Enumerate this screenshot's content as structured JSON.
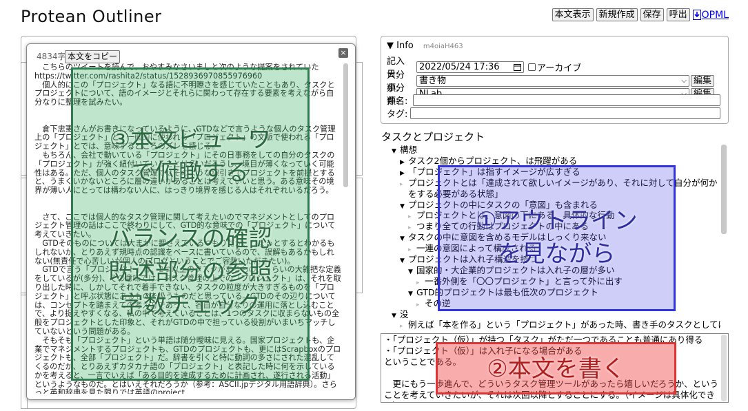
{
  "app": {
    "title": "Protean Outliner"
  },
  "toolbar": {
    "show_body": "本文表示",
    "new": "新規作成",
    "save": "保存",
    "load": "呼出",
    "opml": "OPML"
  },
  "viewer": {
    "char_count": "4834字",
    "copy_label": "本文をコピー",
    "close_label": "×",
    "text": "　こちらのツイートを読んで、おやすみなさいましと次のような提案をされていた\nhttps://twitter.com/rashita2/status/1528936970855976960\n　個人的にこの「プロジェクト」なる語に不明瞭さを感じていたこともあり、タスクとプロジェクトについて、語のイメージとそれらに関わって存在する要素を考えながら自分なりに整理を試みたい。\n\n\n　倉下忠憲さんがお書きになっているように、GTDなどで言うような個人のタスク管理上の「プロジェクト」と、一般的に使われる「プロジェクト」の文脈で使われる「プロジェクト」とでは、意味するところのズレを感じる。\n　もちろん、会社で動いている「プロジェクト」にその日事務をしての自分のタスクの「プロジェクト」が強く紐付いていることは多いだろうし、境目が薄くなっていく可能性はある。ただ、個人のタスク管理ではそのような線引きでプロジェクトを前提とすると、うまくいかないところに層の違いがあることは考えていいと思う。ある意味その境界が薄い人にとっては構わない人に、はっきり境界を感じる人はそれぞれいるだろう。\n\n\n　さて、ここでは個人的なタスク管理に関して考えたいのでマネジメントとしてのプロジェクト管理の話はここで終わりにして、GTD的な意味での「プロジェクト」について考えていきたい。\n　GTDそのものについては大まかに押さえているつもりだが、ひょっとするとわかるもしれないが、とりあえず規時点の認識をベースに書いているので、誤解もあるかもしれない(無責任で心苦しいが個人のブログということでご容赦いただきたい)。\n　GTDで言う「プロジェクト」は、2つ以上のタスクがあるもの、くらいの大雑把な定義をしているが(多分)、その意味では、タスク管理の上での「プロジェクト」は、それを取り出した時に、しかしてそれで着手できない、タスクの粒度が大きすぎるものを「プロジェクト」と呼ぶ状態にあるものを扱うものだと思っている。GTDのその辺りについては、コンセプトを踏まえての考え方であって、各自が自分なりの運用に落とし込むことで、より捉えやすくなる、私の中で考えていることは、1つのタスクに収まらないもの全般をプロジェクトとした印象と、それがGTDの中で担っている役割がいまいちマッチしていないという問題がある。\n　そもそも「プロジェクト」という単語は随分曖昧に見える。国家プロジェクトも、企業でマネジメントするプロジェクトも、GTDのプロジェクトも、更にはScrapboxのプロジェクトも、全部「プロジェクト」だ。辞書を引くと特に動詞の多さにされた混乱してくるのだが、とりあえずカタカナ語の「プロジェクト」と表記した時に何を示しているかを考えると、一言でいえば「ある目的を達成するために計画され、遂行される活動」というようなものだ。とはいえそれだろうか（参考：ASCII.jpデジタル用語辞典）。さらっと英和辞典を見た限りでは英語のproject"
  },
  "info": {
    "heading": "Info",
    "id": "m4oiaH463",
    "date_label": "記入日:",
    "date_value": "2022/05/24 17:36",
    "archive_label": "アーカイブ",
    "category_label": "大分類:",
    "category_value": "書き物",
    "subcategory_label": "小分類:",
    "subcategory_value": "NLab",
    "edit_label": "編集",
    "subject_label": "件名:",
    "subject_value": "",
    "tags_label": "タグ:",
    "tags_value": ""
  },
  "outline": {
    "title": "タスクとプロジェクト",
    "items": [
      {
        "indent": 0,
        "tri": "down",
        "text": "構想"
      },
      {
        "indent": 1,
        "tri": "right",
        "text": "タスク2個からプロジェクト、は飛躍がある"
      },
      {
        "indent": 1,
        "tri": "right",
        "text": "「プロジェクト」は指すイメージが広すぎる"
      },
      {
        "indent": 1,
        "tri": "leaf",
        "text": "プロジェクトとは「達成されて欲しいイメージがあり、それに対して自分が何か"
      },
      {
        "indent": 1,
        "tri": "none",
        "text": "をする必要がある状態」"
      },
      {
        "indent": 1,
        "tri": "down",
        "text": "プロジェクトの中にタスクの「意図」も含まれる"
      },
      {
        "indent": 2,
        "tri": "leaf",
        "text": "プロジェクトとは、意図の下にある、具体的な行動"
      },
      {
        "indent": 2,
        "tri": "leaf",
        "text": "つまり全ての行動はプロジェクトの中にある"
      },
      {
        "indent": 1,
        "tri": "down",
        "text": "タスクの中に意図を含めるモデルはしっくり来ない"
      },
      {
        "indent": 2,
        "tri": "leaf",
        "text": "一連の意図によって構成される"
      },
      {
        "indent": 1,
        "tri": "down",
        "text": "プロジェクトは入れ子構造を持つ"
      },
      {
        "indent": 2,
        "tri": "down",
        "text": "国家的・大企業的プロジェクトは入れ子の層が多い"
      },
      {
        "indent": 3,
        "tri": "leaf",
        "text": "一番外側を「〇〇プロジェクト」と言って外に出す"
      },
      {
        "indent": 2,
        "tri": "down",
        "text": "GTD的プロジェクトは最も低次のプロジェクト"
      },
      {
        "indent": 3,
        "tri": "leaf",
        "text": "その逆"
      },
      {
        "indent": 0,
        "tri": "down",
        "text": "没"
      },
      {
        "indent": 1,
        "tri": "leaf",
        "text": "例えば「本を作る」という「プロジェクト」があった時、書き手のタスクとしては"
      }
    ]
  },
  "body": {
    "text": "・「プロジェクト（仮）」が持つ「タスク」がただ一つであることも普通にあり得る\n・「プロジェクト（仮）」は入れ子になる場合がある\nということである。\n\n　更にもう一歩進んで、どういうタスク管理ツールがあったら嬉しいだろうか、ということを考えていきたいが、それは次回以降とすることにする。（イメージは具体化できた）"
  },
  "annotations": {
    "green_text": "③本文ビューワ\nで俯瞰する\n\nバランスの確認\n既述部分の参照\n字数チェック",
    "blue_text": "①アウトライン\nを見ながら",
    "red_text": "②本文を書く"
  }
}
